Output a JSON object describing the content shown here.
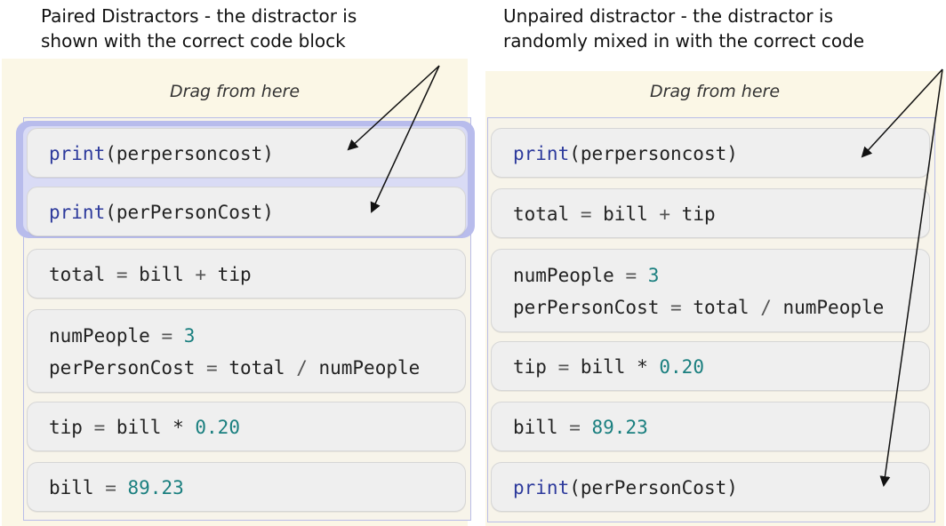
{
  "captions": {
    "left": "Paired Distractors - the distractor is\nshown with the correct code block",
    "right": "Unpaired distractor - the distractor is\nrandomly mixed in with the correct code"
  },
  "left_panel": {
    "drag_label": "Drag from here",
    "paired_blocks": [
      {
        "lines": [
          [
            [
              "kw",
              "print"
            ],
            [
              "str",
              "("
            ],
            [
              "str",
              "perpersoncost"
            ],
            [
              "str",
              ")"
            ]
          ]
        ]
      },
      {
        "lines": [
          [
            [
              "kw",
              "print"
            ],
            [
              "str",
              "("
            ],
            [
              "str",
              "perPersonCost"
            ],
            [
              "str",
              ")"
            ]
          ]
        ]
      }
    ],
    "blocks": [
      {
        "lines": [
          [
            [
              "str",
              "total "
            ],
            [
              "op",
              "="
            ],
            [
              "str",
              " bill "
            ],
            [
              "op",
              "+"
            ],
            [
              "str",
              " tip"
            ]
          ]
        ]
      },
      {
        "lines": [
          [
            [
              "str",
              "numPeople "
            ],
            [
              "op",
              "="
            ],
            [
              "num",
              " 3"
            ]
          ],
          [
            [
              "str",
              "perPersonCost "
            ],
            [
              "op",
              "="
            ],
            [
              "str",
              " total "
            ],
            [
              "op",
              "/"
            ],
            [
              "str",
              " numPeople"
            ]
          ]
        ]
      },
      {
        "lines": [
          [
            [
              "str",
              "tip "
            ],
            [
              "op",
              "="
            ],
            [
              "str",
              " bill "
            ],
            [
              "str",
              "*"
            ],
            [
              "num",
              " 0.20"
            ]
          ]
        ]
      },
      {
        "lines": [
          [
            [
              "str",
              "bill "
            ],
            [
              "op",
              "="
            ],
            [
              "num",
              " 89.23"
            ]
          ]
        ]
      }
    ]
  },
  "right_panel": {
    "drag_label": "Drag from here",
    "blocks": [
      {
        "lines": [
          [
            [
              "kw",
              "print"
            ],
            [
              "str",
              "("
            ],
            [
              "str",
              "perpersoncost"
            ],
            [
              "str",
              ")"
            ]
          ]
        ]
      },
      {
        "lines": [
          [
            [
              "str",
              "total "
            ],
            [
              "op",
              "="
            ],
            [
              "str",
              " bill "
            ],
            [
              "op",
              "+"
            ],
            [
              "str",
              " tip"
            ]
          ]
        ]
      },
      {
        "lines": [
          [
            [
              "str",
              "numPeople "
            ],
            [
              "op",
              "="
            ],
            [
              "num",
              " 3"
            ]
          ],
          [
            [
              "str",
              "perPersonCost "
            ],
            [
              "op",
              "="
            ],
            [
              "str",
              " total "
            ],
            [
              "op",
              "/"
            ],
            [
              "str",
              " numPeople"
            ]
          ]
        ]
      },
      {
        "lines": [
          [
            [
              "str",
              "tip "
            ],
            [
              "op",
              "="
            ],
            [
              "str",
              " bill "
            ],
            [
              "str",
              "*"
            ],
            [
              "num",
              " 0.20"
            ]
          ]
        ]
      },
      {
        "lines": [
          [
            [
              "str",
              "bill "
            ],
            [
              "op",
              "="
            ],
            [
              "num",
              " 89.23"
            ]
          ]
        ]
      },
      {
        "lines": [
          [
            [
              "kw",
              "print"
            ],
            [
              "str",
              "("
            ],
            [
              "str",
              "perPersonCost"
            ],
            [
              "str",
              ")"
            ]
          ]
        ]
      }
    ]
  },
  "colors": {
    "keyword": "#2d3a9c",
    "number": "#1a7f7f",
    "panel_bg": "#fbf7e6",
    "pair_highlight": "#b8bcec"
  }
}
